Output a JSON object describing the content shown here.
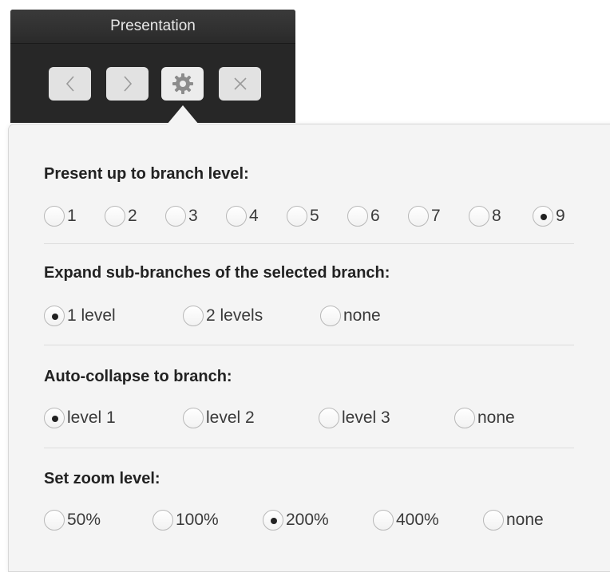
{
  "toolbar": {
    "title": "Presentation",
    "buttons": [
      {
        "name": "previous",
        "icon": "chevron-left-icon"
      },
      {
        "name": "next",
        "icon": "chevron-right-icon"
      },
      {
        "name": "settings",
        "icon": "gear-icon"
      },
      {
        "name": "close",
        "icon": "close-icon"
      }
    ]
  },
  "sections": {
    "branch_level": {
      "title": "Present up to branch level:",
      "options": [
        "1",
        "2",
        "3",
        "4",
        "5",
        "6",
        "7",
        "8",
        "9"
      ],
      "selected": "9"
    },
    "expand": {
      "title": "Expand sub-branches of the selected branch:",
      "options": [
        "1 level",
        "2 levels",
        "none"
      ],
      "selected": "1 level"
    },
    "collapse": {
      "title": "Auto-collapse to branch:",
      "options": [
        "level 1",
        "level 2",
        "level 3",
        "none"
      ],
      "selected": "level 1"
    },
    "zoom": {
      "title": "Set zoom level:",
      "options": [
        "50%",
        "100%",
        "200%",
        "400%",
        "none"
      ],
      "selected": "200%"
    }
  }
}
